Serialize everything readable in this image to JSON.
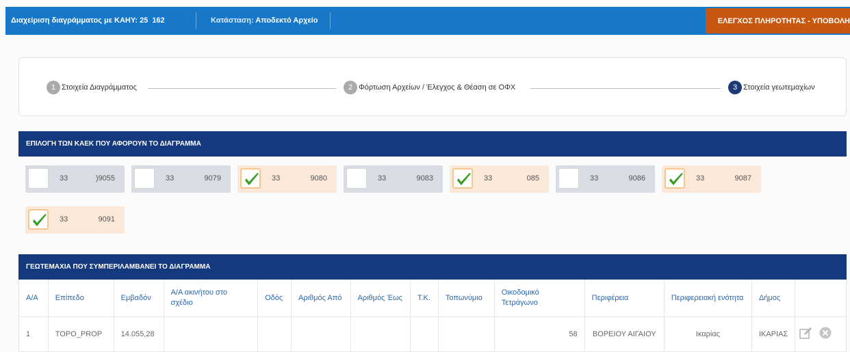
{
  "topbar": {
    "kaek_label": "Διαχείριση διαγράμματος με ΚΑΗΥ: 25",
    "kaek_suffix": "162",
    "status_label": "Κατάσταση:",
    "status_value": "Αποδεκτό Αρχείο",
    "submit_button": "ΕΛΕΓΧΟΣ ΠΛΗΡΟΤΗΤΑΣ - ΥΠΟΒΟΛΗ",
    "colors": {
      "bar": "#1777c8",
      "button": "#c8580f"
    }
  },
  "stepper": {
    "steps": [
      {
        "num": "1",
        "label": "Στοιχεία Διαγράμματος",
        "active": false
      },
      {
        "num": "2",
        "label": "Φόρτωση Αρχείων / Έλεγχος & Θέαση σε ΟΦΧ",
        "active": false
      },
      {
        "num": "3",
        "label": "Στοιχεία γεωτεμαχίων",
        "active": true
      }
    ]
  },
  "kaek_section": {
    "title": "ΕΠΙΛΟΓΗ ΤΩΝ ΚΑΕΚ ΠΟΥ ΑΦΟΡΟΥΝ ΤΟ ΔΙΑΓΡΑΜΜΑ",
    "items": [
      {
        "code1": "33",
        "code2": ")9055",
        "checked": false
      },
      {
        "code1": "33",
        "code2": "9079",
        "checked": false
      },
      {
        "code1": "33",
        "code2": "9080",
        "checked": true
      },
      {
        "code1": "33",
        "code2": "9083",
        "checked": false
      },
      {
        "code1": "33",
        "code2": "085",
        "checked": true
      },
      {
        "code1": "33",
        "code2": "9086",
        "checked": false
      },
      {
        "code1": "33",
        "code2": "9087",
        "checked": true
      },
      {
        "code1": "33",
        "code2": "9091",
        "checked": true
      }
    ]
  },
  "parcels_section": {
    "title": "ΓΕΩΤΕΜΑΧΙΑ ΠΟΥ ΣΥΜΠΕΡΙΛΑΜΒΑΝΕΙ ΤΟ ΔΙΑΓΡΑΜΜΑ",
    "columns": [
      "Α/Α",
      "Επίπεδο",
      "Εμβαδόν",
      "Α/Α ακινήτου στο σχέδιο",
      "Οδός",
      "Αριθμός Από",
      "Αριθμός Έως",
      "Τ.Κ.",
      "Τοπωνύμιο",
      "Οικοδομικό Τετράγωνο",
      "Περιφέρεια",
      "Περιφερειακή ενότητα",
      "Δήμος"
    ],
    "rows": [
      {
        "aa": "1",
        "epipedo": "TOPO_PROP",
        "emvadon": "14.055,28",
        "aa_akinitou": "",
        "odos": "",
        "arithmos_apo": "",
        "arithmos_eos": "",
        "tk": "",
        "toponymio": "",
        "oikodomiko": "58",
        "perifereia": "ΒΟΡΕΙΟΥ ΑΙΓΑΙΟΥ",
        "enotita": "Ικαρίας",
        "dimos": "ΙΚΑΡΙΑΣ"
      }
    ]
  }
}
